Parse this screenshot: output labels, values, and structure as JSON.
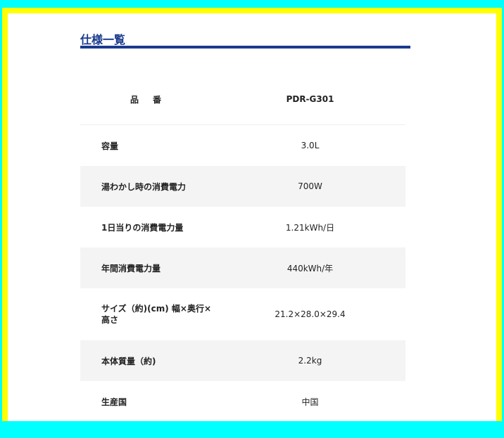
{
  "heading": "仕様一覧",
  "table": {
    "header": {
      "label": "品　番",
      "value": "PDR-G301"
    },
    "rows": [
      {
        "label": "容量",
        "value": "3.0L"
      },
      {
        "label": "湯わかし時の消費電力",
        "value": "700W"
      },
      {
        "label": "1日当りの消費電力量",
        "value": "1.21kWh/日"
      },
      {
        "label": "年間消費電力量",
        "value": "440kWh/年"
      },
      {
        "label": "サイズ（約)(cm) 幅×奥行×高さ",
        "value": "21.2×28.0×29.4"
      },
      {
        "label": "本体質量（約)",
        "value": "2.2kg"
      },
      {
        "label": "生産国",
        "value": "中国"
      }
    ]
  },
  "colors": {
    "accent": "#1a3a8c",
    "outer_border": "#00ffff",
    "inner_border": "#ffff00",
    "row_shade": "#f4f4f4"
  }
}
